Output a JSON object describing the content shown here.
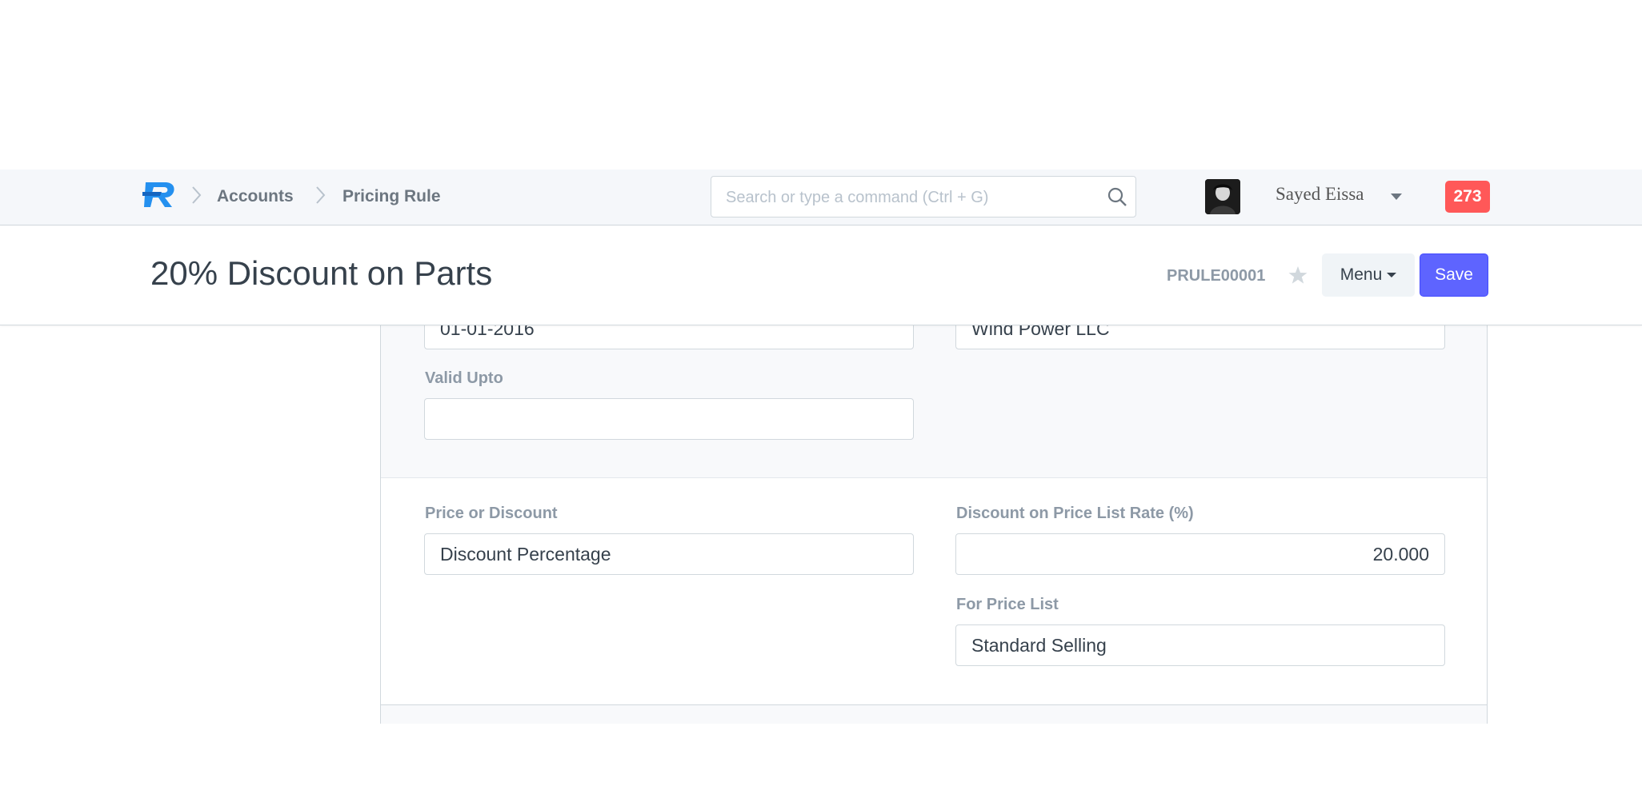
{
  "navbar": {
    "breadcrumbs": [
      "Accounts",
      "Pricing Rule"
    ],
    "search_placeholder": "Search or type a command (Ctrl + G)",
    "user_name": "Sayed Eissa",
    "notification_count": "273",
    "colors": {
      "badge": "#ff5858",
      "logo_primary": "#2490ef"
    }
  },
  "page_head": {
    "title": "20% Discount on Parts",
    "doc_id": "PRULE00001",
    "menu_label": "Menu",
    "save_label": "Save",
    "colors": {
      "save_button": "#5e64ff"
    }
  },
  "form": {
    "valid_from_value": "01-01-2016",
    "party_value": "Wind Power LLC",
    "valid_upto_label": "Valid Upto",
    "valid_upto_value": "",
    "price_or_discount_label": "Price or Discount",
    "price_or_discount_value": "Discount Percentage",
    "discount_rate_label": "Discount on Price List Rate (%)",
    "discount_rate_value": "20.000",
    "for_price_list_label": "For Price List",
    "for_price_list_value": "Standard Selling"
  }
}
